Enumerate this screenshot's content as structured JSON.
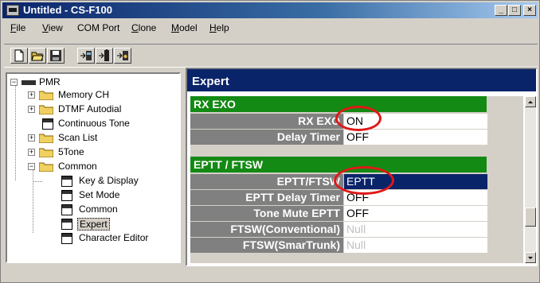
{
  "window": {
    "title": "Untitled - CS-F100",
    "controls": [
      "_",
      "□",
      "×"
    ]
  },
  "menu": [
    {
      "label": "File",
      "u": "F",
      "rest": "ile"
    },
    {
      "label": "View",
      "u": "V",
      "rest": "iew"
    },
    {
      "label": "COM Port",
      "u": "",
      "rest": "COM Port"
    },
    {
      "label": "Clone",
      "u": "C",
      "rest": "lone"
    },
    {
      "label": "Model",
      "u": "M",
      "rest": "odel"
    },
    {
      "label": "Help",
      "u": "H",
      "rest": "elp"
    }
  ],
  "toolbar": {
    "icons": [
      "new-file-icon",
      "open-folder-icon",
      "save-disk-icon",
      "read-from-radio-icon",
      "write-to-radio-icon",
      "radio-settings-icon"
    ]
  },
  "tree": {
    "root": "PMR",
    "items": [
      {
        "label": "Memory CH"
      },
      {
        "label": "DTMF Autodial"
      },
      {
        "label": "Continuous Tone"
      },
      {
        "label": "Scan List"
      },
      {
        "label": "5Tone"
      },
      {
        "label": "Common"
      },
      {
        "label": "Key & Display"
      },
      {
        "label": "Set Mode"
      },
      {
        "label": "Common"
      },
      {
        "label": "Expert"
      },
      {
        "label": "Character Editor"
      }
    ],
    "selected": "Expert"
  },
  "panel": {
    "title": "Expert",
    "sections": [
      {
        "title": "RX EXO",
        "rows": [
          {
            "label": "RX EXO",
            "value": "ON"
          },
          {
            "label": "Delay Timer",
            "value": "OFF"
          }
        ]
      },
      {
        "title": "EPTT / FTSW",
        "rows": [
          {
            "label": "EPTT/FTSW",
            "value": "EPTT"
          },
          {
            "label": "EPTT Delay Timer",
            "value": "OFF"
          },
          {
            "label": "Tone Mute EPTT",
            "value": "OFF"
          },
          {
            "label": "FTSW(Conventional)",
            "value": "Null"
          },
          {
            "label": "FTSW(SmarTrunk)",
            "value": "Null"
          }
        ]
      }
    ]
  },
  "colors": {
    "titlebar": "#0a246a",
    "section": "#138a13",
    "label_bg": "#808080",
    "highlight_ring": "#e01818",
    "selected_value": "#0a246a"
  }
}
